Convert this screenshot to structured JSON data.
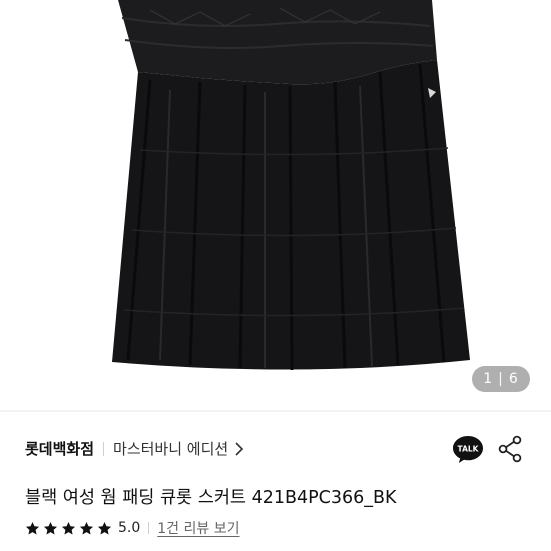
{
  "gallery": {
    "current_index": "1",
    "total": "6"
  },
  "brand_row": {
    "store": "롯데백화점",
    "brand": "마스터바니 에디션"
  },
  "product": {
    "title": "블랙 여성 웜 패딩 큐롯 스커트 421B4PC366_BK"
  },
  "rating": {
    "stars": 5,
    "score": "5.0",
    "review_link": "1건 리뷰 보기"
  },
  "icons": {
    "talk": "kakao-talk-icon",
    "share": "share-icon",
    "chevron": "chevron-right-icon",
    "star": "star-icon"
  },
  "colors": {
    "garment": "#1a1a1c",
    "star": "#111111",
    "badge_bg": "#6e6e6e"
  }
}
